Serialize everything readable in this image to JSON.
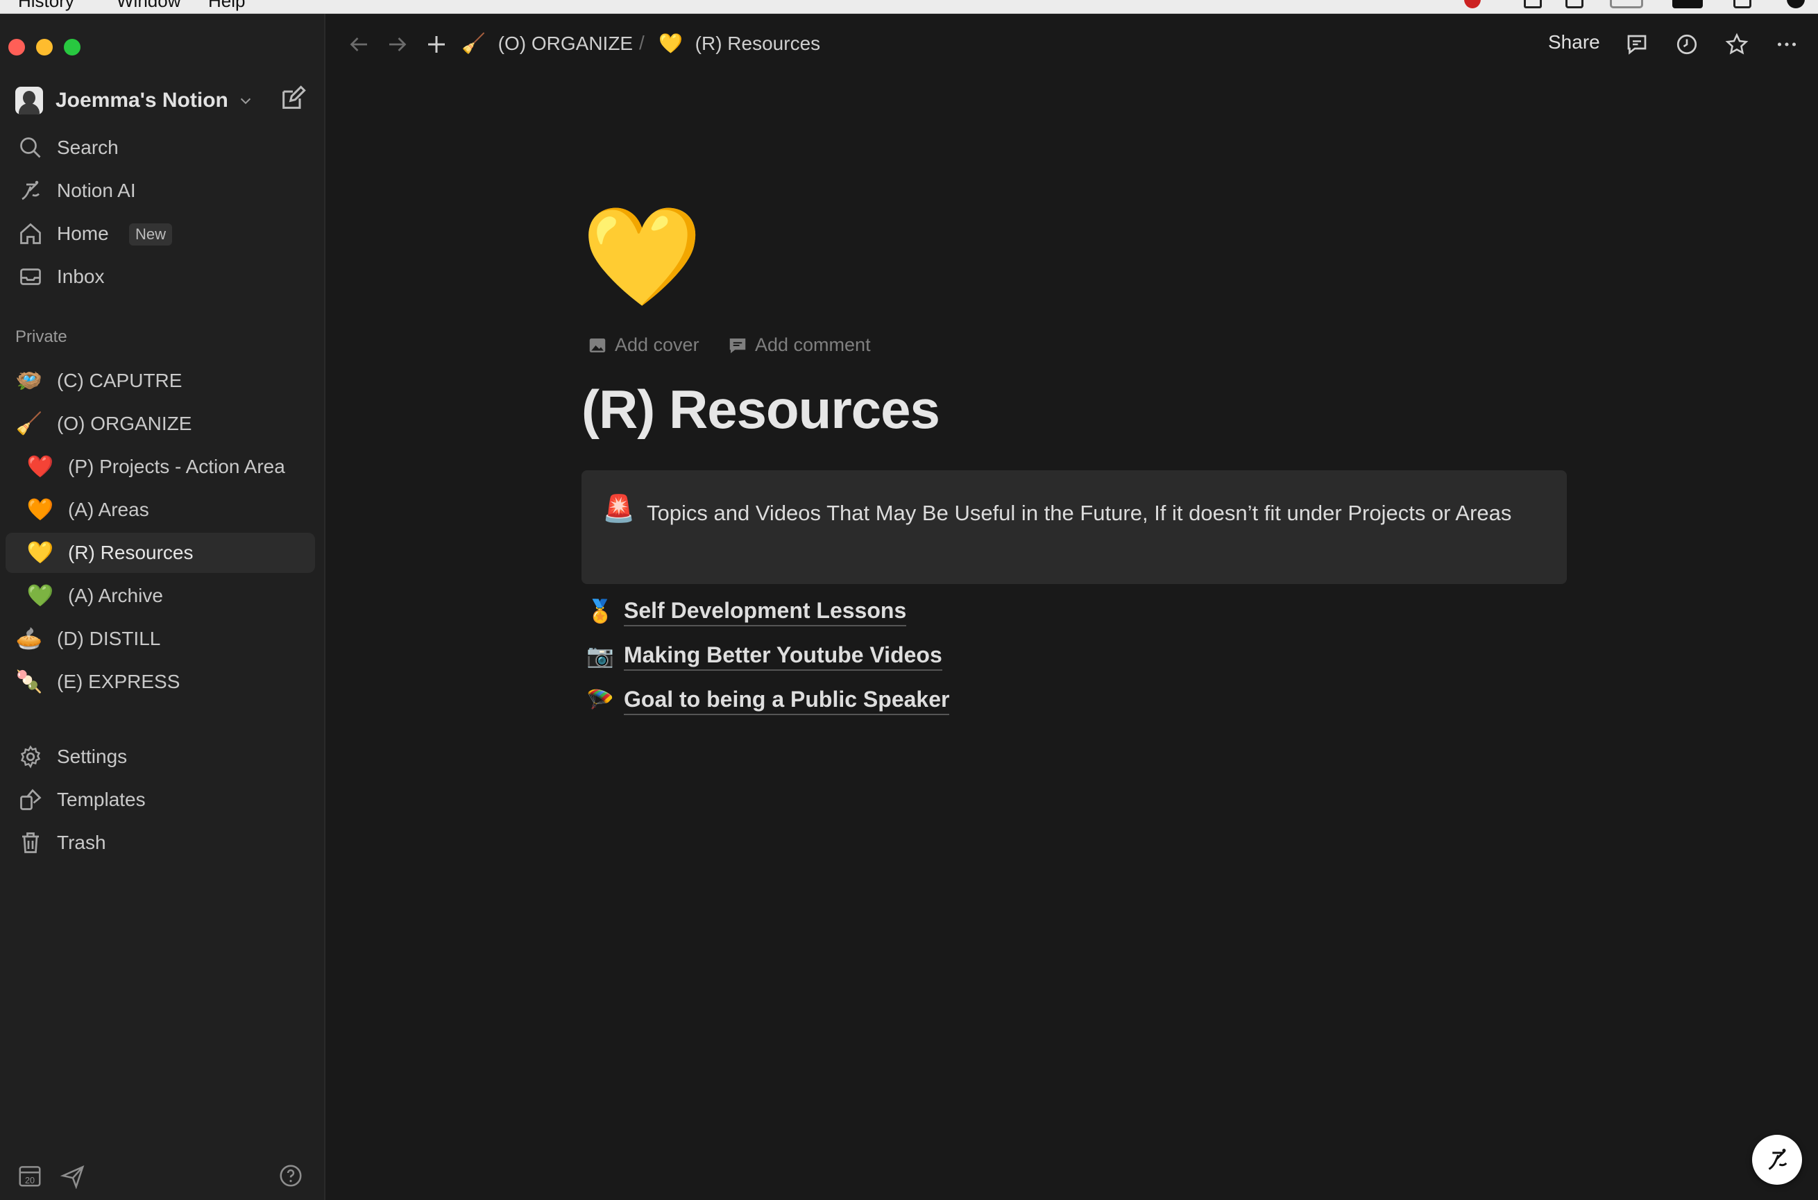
{
  "menubar": {
    "items": [
      "History",
      "Window",
      "Help"
    ]
  },
  "colors": {
    "background": "#191919",
    "sidebar": "#202020",
    "active_row": "#2c2c2c",
    "callout_bg": "#2b2b2b",
    "traffic_red": "#ff5f57",
    "traffic_yellow": "#febc2e",
    "traffic_green": "#28c840"
  },
  "sidebar": {
    "workspace_name": "Joemma's Notion",
    "nav": [
      {
        "label": "Search",
        "icon": "search-icon"
      },
      {
        "label": "Notion AI",
        "icon": "notion-ai-icon"
      },
      {
        "label": "Home",
        "icon": "home-icon",
        "badge": "New"
      },
      {
        "label": "Inbox",
        "icon": "inbox-icon"
      }
    ],
    "section_label": "Private",
    "pages": [
      {
        "emoji": "🪺",
        "label": "(C) CAPUTRE",
        "child": false,
        "active": false
      },
      {
        "emoji": "🧹",
        "label": "(O) ORGANIZE",
        "child": false,
        "active": false
      },
      {
        "emoji": "❤️",
        "label": "(P) Projects - Action Area",
        "child": true,
        "active": false
      },
      {
        "emoji": "🧡",
        "label": "(A) Areas",
        "child": true,
        "active": false
      },
      {
        "emoji": "💛",
        "label": "(R) Resources",
        "child": true,
        "active": true
      },
      {
        "emoji": "💚",
        "label": "(A) Archive",
        "child": true,
        "active": false
      },
      {
        "emoji": "🥧",
        "label": "(D) DISTILL",
        "child": false,
        "active": false
      },
      {
        "emoji": "🍡",
        "label": "(E) EXPRESS",
        "child": false,
        "active": false
      }
    ],
    "footer": [
      {
        "label": "Settings",
        "icon": "gear-icon"
      },
      {
        "label": "Templates",
        "icon": "templates-icon"
      },
      {
        "label": "Trash",
        "icon": "trash-icon"
      }
    ],
    "calendar_day": "20"
  },
  "topbar": {
    "breadcrumb": [
      {
        "emoji": "🧹",
        "label": "(O) ORGANIZE"
      },
      {
        "emoji": "💛",
        "label": "(R) Resources"
      }
    ],
    "separator": "/",
    "share_label": "Share"
  },
  "page": {
    "emoji": "💛",
    "add_cover": "Add cover",
    "add_comment": "Add comment",
    "title": "(R) Resources",
    "callout": {
      "emoji": "🚨",
      "text": "Topics and Videos That May Be Useful in the Future, If it doesn’t fit under Projects or Areas"
    },
    "links": [
      {
        "emoji": "🏅",
        "label": "Self Development Lessons"
      },
      {
        "emoji": "📷",
        "label": "Making Better Youtube Videos"
      },
      {
        "emoji": "🪂",
        "label": "Goal to being a Public Speaker"
      }
    ]
  }
}
